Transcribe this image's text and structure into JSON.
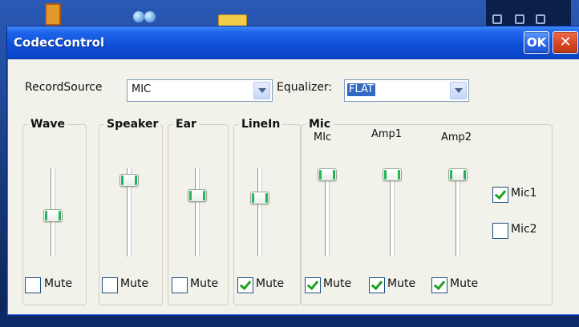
{
  "window": {
    "title": "CodecControl",
    "ok_label": "OK",
    "close_label": "✕"
  },
  "record": {
    "label": "RecordSource",
    "value": "MIC"
  },
  "equalizer": {
    "label": "Equalizer:",
    "value": "FLAT"
  },
  "groups": {
    "wave": {
      "label": "Wave",
      "level": 0.46,
      "mute_label": "Mute",
      "muted": false
    },
    "speaker": {
      "label": "Speaker",
      "level": 0.93,
      "mute_label": "Mute",
      "muted": false
    },
    "ear": {
      "label": "Ear",
      "level": 0.72,
      "mute_label": "Mute",
      "muted": false
    },
    "linein": {
      "label": "LineIn",
      "level": 0.69,
      "mute_label": "Mute",
      "muted": true
    },
    "mic": {
      "label": "Mic",
      "mute_label": "Mute",
      "sliders": [
        {
          "label": "MIc",
          "level": 1.0,
          "muted": true
        },
        {
          "label": "Amp1",
          "level": 1.0,
          "muted": true
        },
        {
          "label": "Amp2",
          "level": 1.0,
          "muted": true
        }
      ],
      "options": [
        {
          "label": "Mic1",
          "checked": true
        },
        {
          "label": "Mic2",
          "checked": false
        }
      ]
    }
  },
  "colors": {
    "titlebar": "#0f50d8",
    "window_bg": "#f2f1ea",
    "thumb_accent": "#26b35a",
    "check": "#21a121"
  }
}
